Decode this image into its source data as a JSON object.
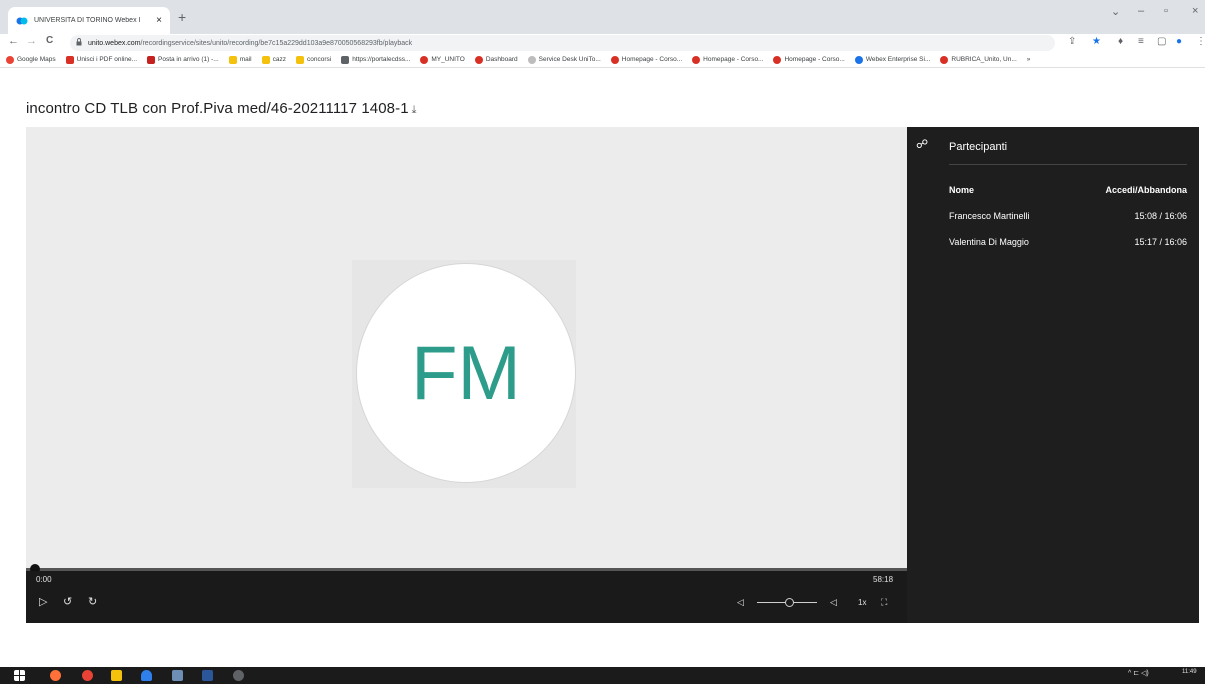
{
  "browser": {
    "tab_title": "UNIVERSITA DI TORINO Webex I",
    "tab_close": "×",
    "new_tab": "+",
    "window_controls": [
      "⌄",
      "–",
      "▫",
      "×"
    ],
    "url_host": "unito.webex.com",
    "url_path": "/recordingservice/sites/unito/recording/be7c15a229dd103a9e870050568293fb/playback",
    "nav": {
      "back": "←",
      "forward": "→",
      "reload": "C"
    },
    "toolbar_icons": [
      "⇪",
      "★",
      "♦",
      "≡",
      "▢",
      "●",
      "⋮"
    ],
    "bookmarks": [
      {
        "label": "Google Maps",
        "color": "#ea4335"
      },
      {
        "label": "Unisci i PDF online...",
        "color": "#d93025"
      },
      {
        "label": "Posta in arrivo (1) -...",
        "color": "#c5221f"
      },
      {
        "label": "mail",
        "color": "#f4c20d"
      },
      {
        "label": "cazz",
        "color": "#f4c20d"
      },
      {
        "label": "concorsi",
        "color": "#f4c20d"
      },
      {
        "label": "https://portalecdss...",
        "color": "#5f6368"
      },
      {
        "label": "MY_UNITO",
        "color": "#d93025"
      },
      {
        "label": "Dashboard",
        "color": "#d93025"
      },
      {
        "label": "Service Desk UniTo...",
        "color": "#bdbdbd"
      },
      {
        "label": "Homepage - Corso...",
        "color": "#d93025"
      },
      {
        "label": "Homepage - Corso...",
        "color": "#d93025"
      },
      {
        "label": "Homepage - Corso...",
        "color": "#d93025"
      },
      {
        "label": "Webex Enterprise Si...",
        "color": "#1a73e8"
      },
      {
        "label": "RUBRICA_Unito, Un...",
        "color": "#d93025"
      }
    ],
    "bookmarks_more": "»"
  },
  "page": {
    "title": "incontro CD TLB con Prof.Piva med/46-20211117 1408-1",
    "download_icon": "⤓"
  },
  "player": {
    "avatar_initials": "FM",
    "accent": "#2e9c8a",
    "current_time": "0:00",
    "duration": "58:18",
    "progress_fraction": 0.0,
    "play_icon": "▷",
    "rewind_icon": "↺",
    "forward_icon": "↻",
    "mute_icon": "◁",
    "volume_icon": "◁",
    "volume_fraction": 0.5,
    "speed": "1x",
    "fullscreen_icon": "⛶"
  },
  "participants": {
    "icon": "☍",
    "title": "Partecipanti",
    "col_name": "Nome",
    "col_time": "Accedi/Abbandona",
    "rows": [
      {
        "name": "Francesco Martinelli",
        "time": "15:08 / 16:06"
      },
      {
        "name": "Valentina Di Maggio",
        "time": "15:17 / 16:06"
      }
    ]
  },
  "taskbar": {
    "clock": "11:49",
    "tray_icons": "^ ⊏ ◁)"
  }
}
